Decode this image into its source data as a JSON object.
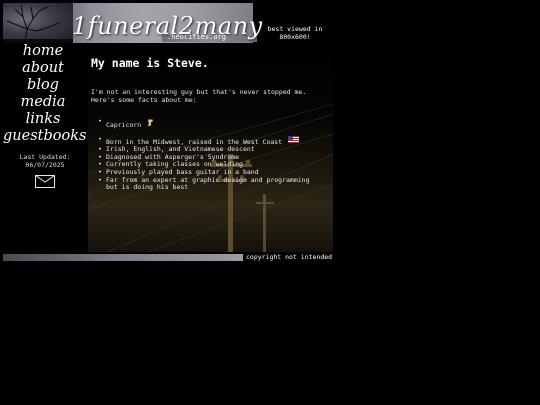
{
  "site": {
    "title": "1funeral2many",
    "subtitle": ".neocities.org",
    "best_viewed_line1": "best viewed in",
    "best_viewed_line2": "800x600!"
  },
  "nav": {
    "items": [
      {
        "label": "home"
      },
      {
        "label": "about"
      },
      {
        "label": "blog"
      },
      {
        "label": "media"
      },
      {
        "label": "links"
      },
      {
        "label": "guestbooks"
      }
    ]
  },
  "last_updated": {
    "label": "Last Updated:",
    "date": "06/07/2025"
  },
  "content": {
    "heading": "My name is Steve.",
    "intro_line1": "I'm not an interesting guy but that's never stopped me.",
    "intro_line2": "Here's some facts about me:",
    "facts": [
      {
        "text": "Capricorn"
      },
      {
        "text": "Born in the Midwest, raised in the West Coast"
      },
      {
        "text": "Irish, English, and Vietnamese descent"
      },
      {
        "text": "Diagnosed with Asperger's Syndrome"
      },
      {
        "text": "Currently taking classes on welding"
      },
      {
        "text": "Previously played bass guitar in a band"
      },
      {
        "text_line1": "Far from an expert at graphic design and programming",
        "text_line2": "but is doing his best"
      }
    ]
  },
  "footer": {
    "copyright": "copyright not intended"
  },
  "icons": {
    "mail": "envelope-icon",
    "capricorn": "goat-icon",
    "flag": "us-flag-icon"
  },
  "colors": {
    "background": "#000000",
    "text": "#ffffff"
  }
}
